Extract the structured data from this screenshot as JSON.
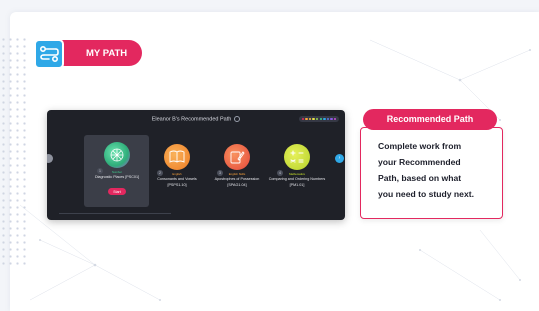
{
  "badge": {
    "label": "MY PATH",
    "icon": "path-flow-icon",
    "color": "#e3285f",
    "icon_bg": "#2fa8e7"
  },
  "screen": {
    "title": "Eleanor B's Recommended Path",
    "progress_dot_colors": [
      "#e3285f",
      "#f7a13b",
      "#f7c13b",
      "#e7e04a",
      "#8fd14f",
      "#3fcf8e",
      "#2fa8e7",
      "#5a76e8",
      "#8a5ae8",
      "#c84fd8"
    ],
    "nodes": [
      {
        "number": "1",
        "category": "Number",
        "label_lines": [
          "Diagnostic Places [PSC01]"
        ],
        "button": "Start",
        "icon": "diagnostic-icon",
        "color": "#3fcf8e",
        "cat_color": "#3fcf8e"
      },
      {
        "number": "2",
        "category": "English",
        "label_lines": [
          "Consonants and Vowels",
          "[PSPS1.10]"
        ],
        "icon": "book-icon",
        "color": "#f28a2e",
        "cat_color": "#f7a13b"
      },
      {
        "number": "3",
        "category": "English Skills",
        "label_lines": [
          "Apostrophes of Possession",
          "[SPAG1.04]"
        ],
        "icon": "pencil-icon",
        "color": "#f05a3a",
        "cat_color": "#f7a13b"
      },
      {
        "number": "4",
        "category": "Mathematics",
        "label_lines": [
          "Comparing and Ordering Numbers",
          "[PM1.01]"
        ],
        "icon": "math-symbols-icon",
        "color": "#c6e02b",
        "cat_color": "#c6e02b"
      }
    ]
  },
  "callout": {
    "header": "Recommended Path",
    "lines": [
      "Complete work from",
      "your Recommended",
      "Path, based on what",
      "you need to study next."
    ],
    "accent": "#e3285f"
  }
}
